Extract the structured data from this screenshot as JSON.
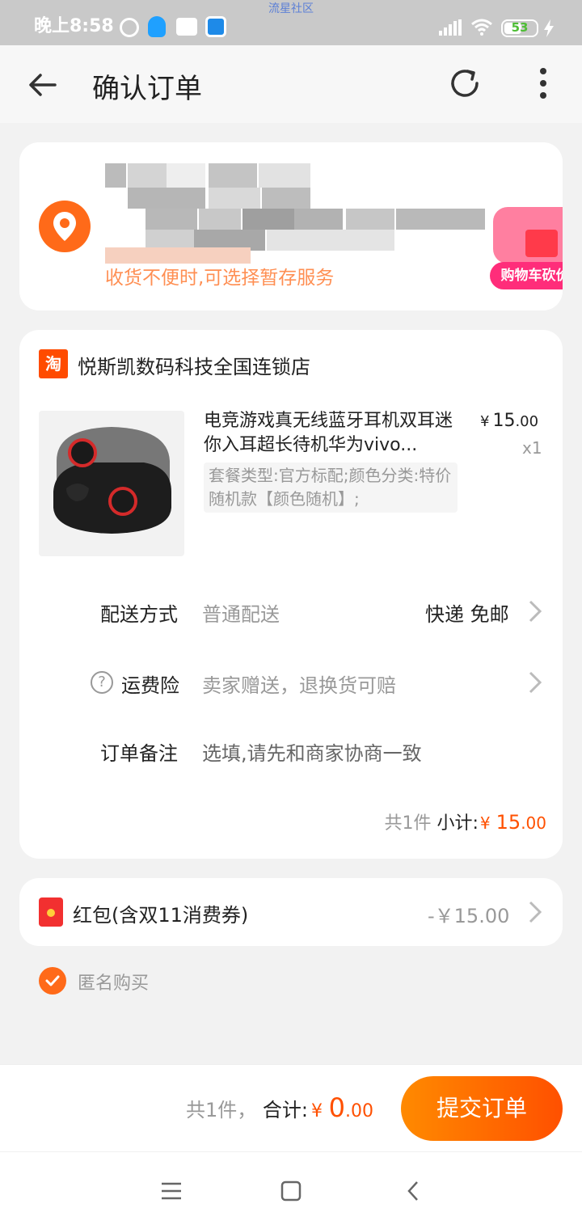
{
  "status_bar": {
    "time": "晚上8:58",
    "watermark": "流星社区",
    "battery": "53",
    "icons": [
      "alarm-icon",
      "qq-icon",
      "message-icon",
      "app-icon",
      "signal-icon",
      "wifi-icon",
      "battery-icon",
      "charging-icon"
    ]
  },
  "header": {
    "title": "确认订单",
    "icons": [
      "back-arrow-icon",
      "refresh-icon",
      "more-icon"
    ]
  },
  "address": {
    "tip": "收货不便时,可选择暂存服务",
    "bargain_badge": "购物车砍价"
  },
  "shop": {
    "logo": "淘",
    "name": "悦斯凯数码科技全国连锁店"
  },
  "product": {
    "title": "电竞游戏真无线蓝牙耳机双耳迷你入耳超长待机华为vivo...",
    "sku": "套餐类型:官方标配;颜色分类:特价随机款【颜色随机】;",
    "price_currency": "¥",
    "price_int": "15",
    "price_dec": ".00",
    "qty": "x1"
  },
  "delivery": {
    "label": "配送方式",
    "value": "普通配送",
    "right": "快递 免邮"
  },
  "insurance": {
    "label": "运费险",
    "value": "卖家赠送，退换货可赔"
  },
  "remark": {
    "label": "订单备注",
    "placeholder": "选填,请先和商家协商一致"
  },
  "subtotal": {
    "count": "共1件",
    "label": "小计:",
    "currency": "¥",
    "int": "15",
    "dec": ".00"
  },
  "red_packet": {
    "label": "红包(含双11消费券)",
    "amount": "-￥15.00"
  },
  "anonymous": {
    "label": "匿名购买",
    "checked": true
  },
  "footer": {
    "count": "共1件，",
    "label": "合计:",
    "currency": "¥",
    "int": "0",
    "dec": ".00",
    "submit": "提交订单"
  },
  "colors": {
    "accent": "#ff5000",
    "accent_light": "#ff8a00",
    "header_bg": "#f7f7f7",
    "page_bg": "#f2f2f2"
  }
}
